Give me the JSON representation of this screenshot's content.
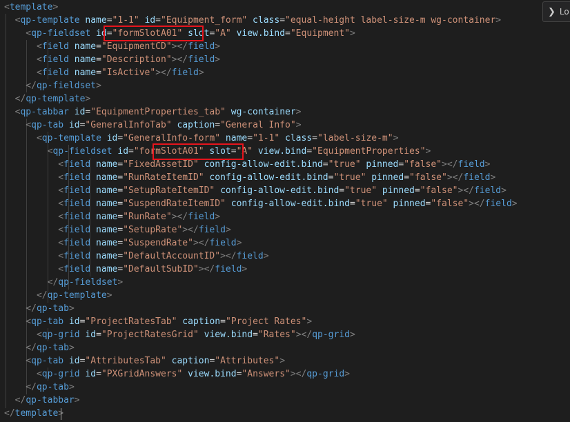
{
  "editor": {
    "language": "xml",
    "lines": [
      [
        [
          "t",
          "template"
        ],
        [
          "b",
          ">"
        ]
      ],
      [
        [
          "b",
          "  <"
        ],
        [
          "t",
          "qp-template"
        ],
        [
          "a",
          " name"
        ],
        [
          "e",
          "="
        ],
        [
          "s",
          "\"1-1\""
        ],
        [
          "a",
          " id"
        ],
        [
          "e",
          "="
        ],
        [
          "s",
          "\"Equipment_form\""
        ],
        [
          "a",
          " class"
        ],
        [
          "e",
          "="
        ],
        [
          "s",
          "\"equal-height label-size-m wg-container"
        ],
        [
          "b",
          ">"
        ]
      ],
      [
        [
          "b",
          "    <"
        ],
        [
          "t",
          "qp-fieldset"
        ],
        [
          "a",
          " id"
        ],
        [
          "e",
          "="
        ],
        [
          "s",
          "\"formSlotA01\""
        ],
        [
          "a",
          " slot"
        ],
        [
          "e",
          "="
        ],
        [
          "s",
          "\"A\""
        ],
        [
          "a",
          " view.bind"
        ],
        [
          "e",
          "="
        ],
        [
          "s",
          "\"Equipment\""
        ],
        [
          "b",
          ">"
        ]
      ],
      [
        [
          "b",
          "      <"
        ],
        [
          "t",
          "field"
        ],
        [
          "a",
          " name"
        ],
        [
          "e",
          "="
        ],
        [
          "s",
          "\"EquipmentCD\""
        ],
        [
          "b",
          ">"
        ],
        [
          "b",
          "</"
        ],
        [
          "t",
          "field"
        ],
        [
          "b",
          ">"
        ]
      ],
      [
        [
          "b",
          "      <"
        ],
        [
          "t",
          "field"
        ],
        [
          "a",
          " name"
        ],
        [
          "e",
          "="
        ],
        [
          "s",
          "\"Description\""
        ],
        [
          "b",
          ">"
        ],
        [
          "b",
          "</"
        ],
        [
          "t",
          "field"
        ],
        [
          "b",
          ">"
        ]
      ],
      [
        [
          "b",
          "      <"
        ],
        [
          "t",
          "field"
        ],
        [
          "a",
          " name"
        ],
        [
          "e",
          "="
        ],
        [
          "s",
          "\"IsActive\""
        ],
        [
          "b",
          ">"
        ],
        [
          "b",
          "</"
        ],
        [
          "t",
          "field"
        ],
        [
          "b",
          ">"
        ]
      ],
      [
        [
          "b",
          "    </"
        ],
        [
          "t",
          "qp-fieldset"
        ],
        [
          "b",
          ">"
        ]
      ],
      [
        [
          "b",
          "  </"
        ],
        [
          "t",
          "qp-template"
        ],
        [
          "b",
          ">"
        ]
      ],
      [
        [
          "b",
          "  <"
        ],
        [
          "t",
          "qp-tabbar"
        ],
        [
          "a",
          " id"
        ],
        [
          "e",
          "="
        ],
        [
          "s",
          "\"EquipmentProperties_tab\""
        ],
        [
          "a",
          " wg-container"
        ],
        [
          "b",
          ">"
        ]
      ],
      [
        [
          "b",
          "    <"
        ],
        [
          "t",
          "qp-tab"
        ],
        [
          "a",
          " id"
        ],
        [
          "e",
          "="
        ],
        [
          "s",
          "\"GeneralInfoTab\""
        ],
        [
          "a",
          " caption"
        ],
        [
          "e",
          "="
        ],
        [
          "s",
          "\"General Info\""
        ],
        [
          "b",
          ">"
        ]
      ],
      [
        [
          "b",
          "      <"
        ],
        [
          "t",
          "qp-template"
        ],
        [
          "a",
          " id"
        ],
        [
          "e",
          "="
        ],
        [
          "s",
          "\"GeneralInfo-form\""
        ],
        [
          "a",
          " name"
        ],
        [
          "e",
          "="
        ],
        [
          "s",
          "\"1-1\""
        ],
        [
          "a",
          " class"
        ],
        [
          "e",
          "="
        ],
        [
          "s",
          "\"label-size-m\""
        ],
        [
          "b",
          ">"
        ]
      ],
      [
        [
          "b",
          "        <"
        ],
        [
          "t",
          "qp-fieldset"
        ],
        [
          "a",
          " id"
        ],
        [
          "e",
          "="
        ],
        [
          "s",
          "\"formSlotA01\""
        ],
        [
          "a",
          " slot"
        ],
        [
          "e",
          "="
        ],
        [
          "s",
          "\"A\""
        ],
        [
          "a",
          " view.bind"
        ],
        [
          "e",
          "="
        ],
        [
          "s",
          "\"EquipmentProperties\""
        ],
        [
          "b",
          ">"
        ]
      ],
      [
        [
          "b",
          "          <"
        ],
        [
          "t",
          "field"
        ],
        [
          "a",
          " name"
        ],
        [
          "e",
          "="
        ],
        [
          "s",
          "\"FixedAssetID\""
        ],
        [
          "a",
          " config-allow-edit.bind"
        ],
        [
          "e",
          "="
        ],
        [
          "s",
          "\"true\""
        ],
        [
          "a",
          " pinned"
        ],
        [
          "e",
          "="
        ],
        [
          "s",
          "\"false\""
        ],
        [
          "b",
          ">"
        ],
        [
          "b",
          "</"
        ],
        [
          "t",
          "field"
        ],
        [
          "b",
          ">"
        ]
      ],
      [
        [
          "b",
          "          <"
        ],
        [
          "t",
          "field"
        ],
        [
          "a",
          " name"
        ],
        [
          "e",
          "="
        ],
        [
          "s",
          "\"RunRateItemID\""
        ],
        [
          "a",
          " config-allow-edit.bind"
        ],
        [
          "e",
          "="
        ],
        [
          "s",
          "\"true\""
        ],
        [
          "a",
          " pinned"
        ],
        [
          "e",
          "="
        ],
        [
          "s",
          "\"false\""
        ],
        [
          "b",
          ">"
        ],
        [
          "b",
          "</"
        ],
        [
          "t",
          "field"
        ],
        [
          "b",
          ">"
        ]
      ],
      [
        [
          "b",
          "          <"
        ],
        [
          "t",
          "field"
        ],
        [
          "a",
          " name"
        ],
        [
          "e",
          "="
        ],
        [
          "s",
          "\"SetupRateItemID\""
        ],
        [
          "a",
          " config-allow-edit.bind"
        ],
        [
          "e",
          "="
        ],
        [
          "s",
          "\"true\""
        ],
        [
          "a",
          " pinned"
        ],
        [
          "e",
          "="
        ],
        [
          "s",
          "\"false\""
        ],
        [
          "b",
          ">"
        ],
        [
          "b",
          "</"
        ],
        [
          "t",
          "field"
        ],
        [
          "b",
          ">"
        ]
      ],
      [
        [
          "b",
          "          <"
        ],
        [
          "t",
          "field"
        ],
        [
          "a",
          " name"
        ],
        [
          "e",
          "="
        ],
        [
          "s",
          "\"SuspendRateItemID\""
        ],
        [
          "a",
          " config-allow-edit.bind"
        ],
        [
          "e",
          "="
        ],
        [
          "s",
          "\"true\""
        ],
        [
          "a",
          " pinned"
        ],
        [
          "e",
          "="
        ],
        [
          "s",
          "\"false\""
        ],
        [
          "b",
          ">"
        ],
        [
          "b",
          "</"
        ],
        [
          "t",
          "field"
        ],
        [
          "b",
          ">"
        ]
      ],
      [
        [
          "b",
          "          <"
        ],
        [
          "t",
          "field"
        ],
        [
          "a",
          " name"
        ],
        [
          "e",
          "="
        ],
        [
          "s",
          "\"RunRate\""
        ],
        [
          "b",
          ">"
        ],
        [
          "b",
          "</"
        ],
        [
          "t",
          "field"
        ],
        [
          "b",
          ">"
        ]
      ],
      [
        [
          "b",
          "          <"
        ],
        [
          "t",
          "field"
        ],
        [
          "a",
          " name"
        ],
        [
          "e",
          "="
        ],
        [
          "s",
          "\"SetupRate\""
        ],
        [
          "b",
          ">"
        ],
        [
          "b",
          "</"
        ],
        [
          "t",
          "field"
        ],
        [
          "b",
          ">"
        ]
      ],
      [
        [
          "b",
          "          <"
        ],
        [
          "t",
          "field"
        ],
        [
          "a",
          " name"
        ],
        [
          "e",
          "="
        ],
        [
          "s",
          "\"SuspendRate\""
        ],
        [
          "b",
          ">"
        ],
        [
          "b",
          "</"
        ],
        [
          "t",
          "field"
        ],
        [
          "b",
          ">"
        ]
      ],
      [
        [
          "b",
          "          <"
        ],
        [
          "t",
          "field"
        ],
        [
          "a",
          " name"
        ],
        [
          "e",
          "="
        ],
        [
          "s",
          "\"DefaultAccountID\""
        ],
        [
          "b",
          ">"
        ],
        [
          "b",
          "</"
        ],
        [
          "t",
          "field"
        ],
        [
          "b",
          ">"
        ]
      ],
      [
        [
          "b",
          "          <"
        ],
        [
          "t",
          "field"
        ],
        [
          "a",
          " name"
        ],
        [
          "e",
          "="
        ],
        [
          "s",
          "\"DefaultSubID\""
        ],
        [
          "b",
          ">"
        ],
        [
          "b",
          "</"
        ],
        [
          "t",
          "field"
        ],
        [
          "b",
          ">"
        ]
      ],
      [
        [
          "b",
          "        </"
        ],
        [
          "t",
          "qp-fieldset"
        ],
        [
          "b",
          ">"
        ]
      ],
      [
        [
          "b",
          "      </"
        ],
        [
          "t",
          "qp-template"
        ],
        [
          "b",
          ">"
        ]
      ],
      [
        [
          "b",
          "    </"
        ],
        [
          "t",
          "qp-tab"
        ],
        [
          "b",
          ">"
        ]
      ],
      [
        [
          "b",
          "    <"
        ],
        [
          "t",
          "qp-tab"
        ],
        [
          "a",
          " id"
        ],
        [
          "e",
          "="
        ],
        [
          "s",
          "\"ProjectRatesTab\""
        ],
        [
          "a",
          " caption"
        ],
        [
          "e",
          "="
        ],
        [
          "s",
          "\"Project Rates\""
        ],
        [
          "b",
          ">"
        ]
      ],
      [
        [
          "b",
          "      <"
        ],
        [
          "t",
          "qp-grid"
        ],
        [
          "a",
          " id"
        ],
        [
          "e",
          "="
        ],
        [
          "s",
          "\"ProjectRatesGrid\""
        ],
        [
          "a",
          " view.bind"
        ],
        [
          "e",
          "="
        ],
        [
          "s",
          "\"Rates\""
        ],
        [
          "b",
          ">"
        ],
        [
          "b",
          "</"
        ],
        [
          "t",
          "qp-grid"
        ],
        [
          "b",
          ">"
        ]
      ],
      [
        [
          "b",
          "    </"
        ],
        [
          "t",
          "qp-tab"
        ],
        [
          "b",
          ">"
        ]
      ],
      [
        [
          "b",
          "    <"
        ],
        [
          "t",
          "qp-tab"
        ],
        [
          "a",
          " id"
        ],
        [
          "e",
          "="
        ],
        [
          "s",
          "\"AttributesTab\""
        ],
        [
          "a",
          " caption"
        ],
        [
          "e",
          "="
        ],
        [
          "s",
          "\"Attributes\""
        ],
        [
          "b",
          ">"
        ]
      ],
      [
        [
          "b",
          "      <"
        ],
        [
          "t",
          "qp-grid"
        ],
        [
          "a",
          " id"
        ],
        [
          "e",
          "="
        ],
        [
          "s",
          "\"PXGridAnswers\""
        ],
        [
          "a",
          " view.bind"
        ],
        [
          "e",
          "="
        ],
        [
          "s",
          "\"Answers\""
        ],
        [
          "b",
          ">"
        ],
        [
          "b",
          "</"
        ],
        [
          "t",
          "qp-grid"
        ],
        [
          "b",
          ">"
        ]
      ],
      [
        [
          "b",
          "    </"
        ],
        [
          "t",
          "qp-tab"
        ],
        [
          "b",
          ">"
        ]
      ],
      [
        [
          "b",
          "  </"
        ],
        [
          "t",
          "qp-tabbar"
        ],
        [
          "b",
          ">"
        ]
      ],
      [
        [
          "b",
          "</"
        ],
        [
          "t",
          "template"
        ],
        [
          "b",
          ">"
        ]
      ]
    ]
  },
  "overlay": {
    "label": "Lo",
    "icon": "chevron-right-icon"
  },
  "colors": {
    "background": "#1e1e1e",
    "tag": "#569cd6",
    "attribute": "#9cdcfe",
    "string": "#ce9178",
    "bracket": "#808080",
    "highlight_box": "#e8141c"
  }
}
